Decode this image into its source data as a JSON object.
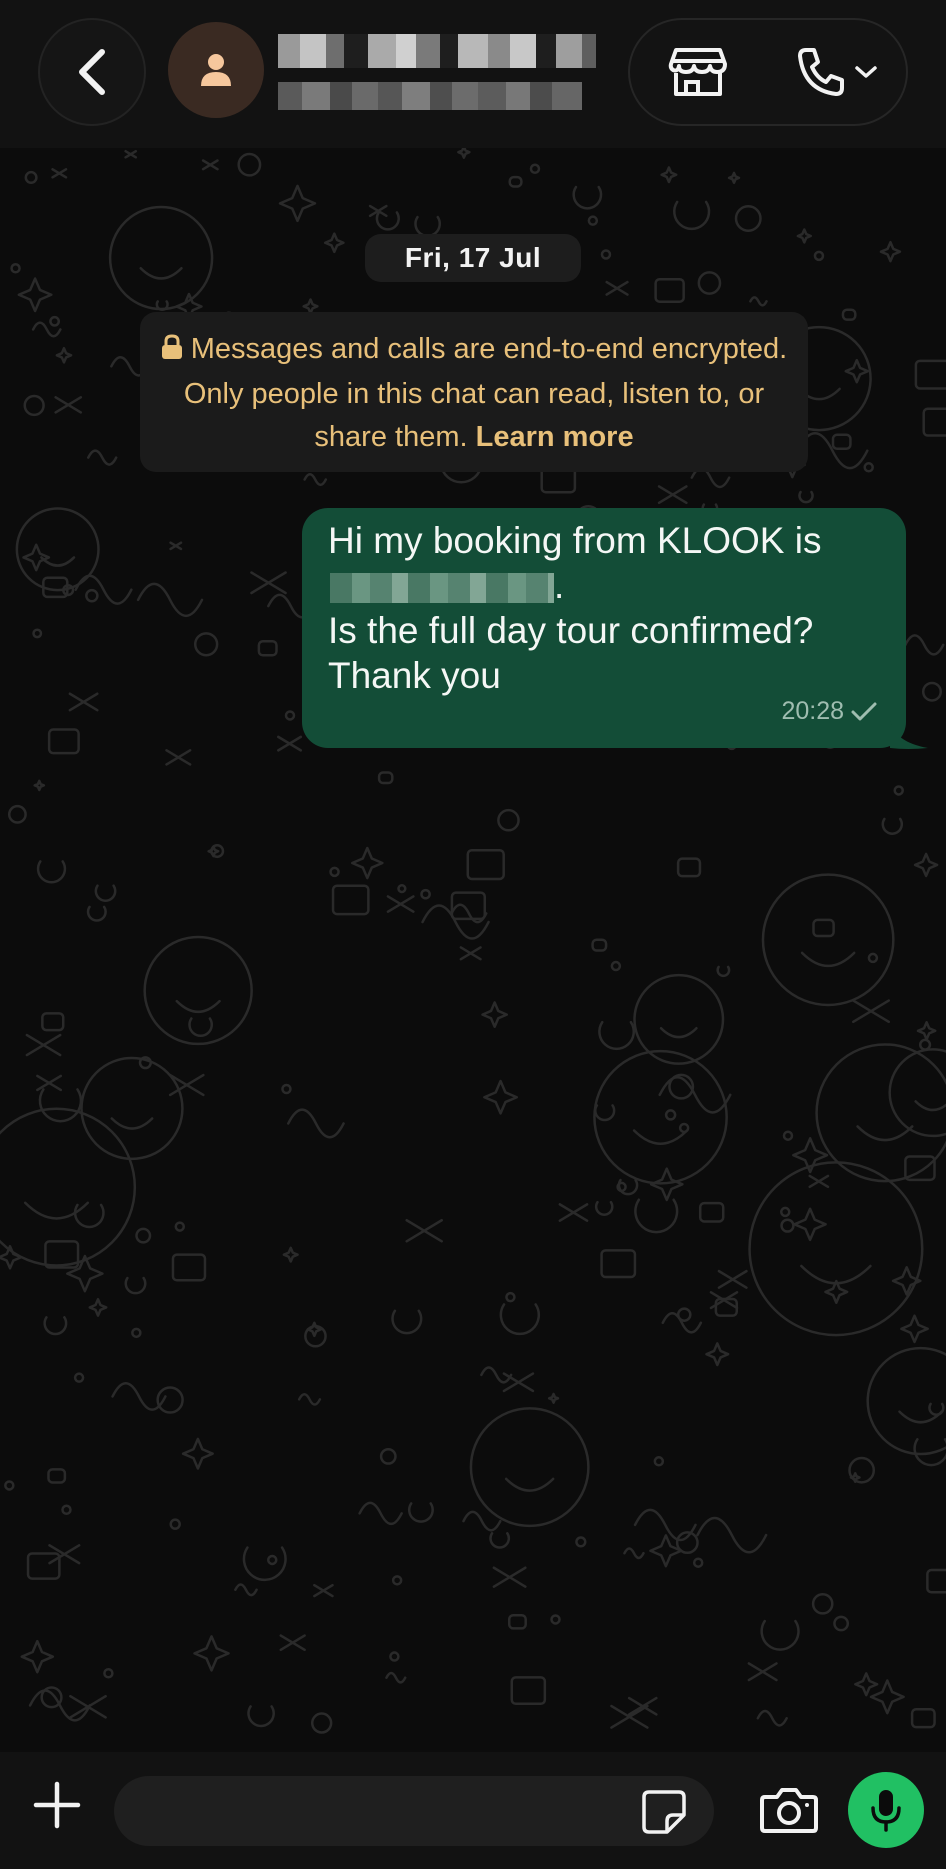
{
  "header": {
    "back_icon": "chevron-left-icon",
    "avatar_icon": "person-icon",
    "contact_name": "",
    "contact_subtitle": "",
    "store_icon": "storefront-icon",
    "call_icon": "phone-icon",
    "call_menu_icon": "chevron-down-icon"
  },
  "chat": {
    "date_chip": "Fri, 17 Jul",
    "encryption_notice": {
      "lock_icon": "lock-icon",
      "text": "Messages and calls are end-to-end encrypted. Only people in this chat can read, listen to, or share them.",
      "link": "Learn more"
    },
    "messages": [
      {
        "direction": "outgoing",
        "line1": "Hi my booking from KLOOK is",
        "line2_suffix": ".",
        "line3": "Is the full day tour confirmed?",
        "line4": "Thank you",
        "time": "20:28",
        "status_icon": "single-check-icon"
      }
    ]
  },
  "composer": {
    "plus_icon": "plus-icon",
    "input_value": "",
    "input_placeholder": "",
    "sticker_icon": "sticker-icon",
    "camera_icon": "camera-icon",
    "mic_icon": "microphone-icon"
  },
  "colors": {
    "background": "#0c0c0c",
    "header": "#121212",
    "outgoing_bubble": "#134d37",
    "notice_text": "#e8c07a",
    "accent_green": "#21c063",
    "doodle_stroke": "#2a2a2a"
  }
}
